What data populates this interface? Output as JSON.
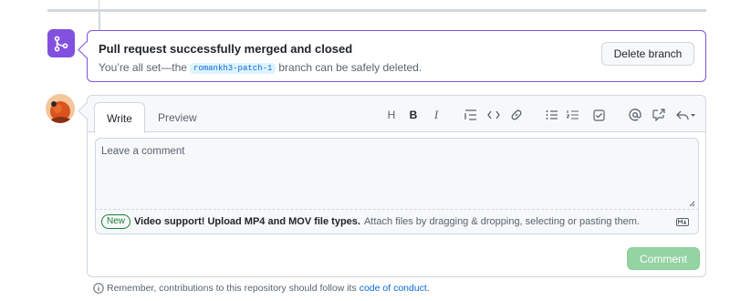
{
  "merged": {
    "title": "Pull request successfully merged and closed",
    "sub_prefix": "You’re all set—the",
    "branch": "romankh3-patch-1",
    "sub_suffix": "branch can be safely deleted.",
    "delete_button": "Delete branch"
  },
  "composer": {
    "tabs": [
      "Write",
      "Preview"
    ],
    "toolbar_icons": [
      "heading-icon",
      "bold-icon",
      "italic-icon",
      "quote-icon",
      "code-icon",
      "link-icon",
      "unordered-list-icon",
      "ordered-list-icon",
      "task-list-icon",
      "mention-icon",
      "cross-reference-icon",
      "saved-replies-icon"
    ],
    "toolbar": {
      "heading": "H",
      "bold": "B",
      "italic": "I"
    },
    "placeholder": "Leave a comment",
    "attach": {
      "badge": "New",
      "strong": "Video support! Upload MP4 and MOV file types.",
      "text": "Attach files by dragging & dropping, selecting or pasting them."
    },
    "submit": "Comment"
  },
  "footer": {
    "text": "Remember, contributions to this repository should follow its",
    "link": "code of conduct",
    "end": "."
  },
  "colors": {
    "merged_purple": "#8250df",
    "link_blue": "#0969da",
    "success_green": "#1a7f37",
    "disabled_button": "#94d3a2"
  }
}
